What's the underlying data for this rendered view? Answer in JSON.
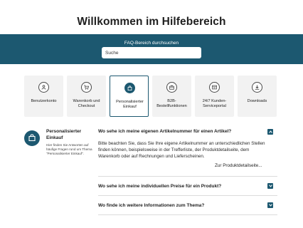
{
  "header": {
    "title": "Willkommen im Hilfebereich"
  },
  "search": {
    "label": "FAQ-Bereich durchsuchen",
    "placeholder": "Suche",
    "value": ""
  },
  "categories": [
    {
      "label": "Benutzerkonto",
      "icon": "user-icon"
    },
    {
      "label": "Warenkorb und Checkout",
      "icon": "cart-icon"
    },
    {
      "label": "Personalisierter Einkauf",
      "icon": "shopping-bag-icon",
      "active": true
    },
    {
      "label": "B2B-Bestellfunktionen",
      "icon": "briefcase-icon"
    },
    {
      "label": "24/7 Kunden-Serviceportal",
      "icon": "portal-icon"
    },
    {
      "label": "Downloads",
      "icon": "download-icon"
    }
  ],
  "section": {
    "title": "Personalisierter Einkauf",
    "description": "Hier finden Sie Antworten auf häufige Fragen rund um Thema \"Personalisierter Einkauf\"."
  },
  "faqs": [
    {
      "question": "Wo sehe ich meine eigenen Artikelnummer für einen Artikel?",
      "answer": "Bitte beachten Sie, dass Sie Ihre eigene Artikelnummer an unterschiedlichen Stellen finden können, beispielsweise in der Trefferliste, der Produktdetailseite, dem Warenkorb oder auf Rechnungen und Lieferscheinen.",
      "link": "Zur Produktdetailseite...",
      "expanded": true
    },
    {
      "question": "Wo sehe ich meine individuellen Preise für ein Produkt?",
      "expanded": false
    },
    {
      "question": "Wo finde ich weitere Informationen zum Thema?",
      "expanded": false
    }
  ],
  "colors": {
    "accent": "#1c5870",
    "card_bg": "#f2f2f2"
  }
}
